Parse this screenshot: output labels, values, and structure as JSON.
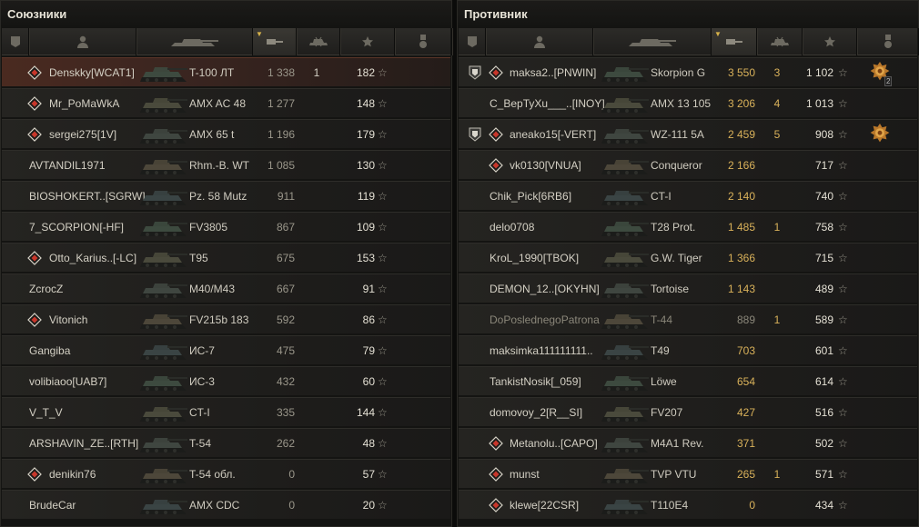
{
  "left": {
    "title": "Союзники",
    "rows": [
      {
        "name": "Denskky[WCAT1]",
        "vehicle": "T-100 ЛТ",
        "damage": "1 338",
        "frags": "1",
        "xp": "182",
        "platoon": true,
        "self": true
      },
      {
        "name": "Mr_PoMaWkA",
        "vehicle": "AMX AC 48",
        "damage": "1 277",
        "frags": "",
        "xp": "148",
        "platoon": true,
        "self": false
      },
      {
        "name": "sergei275[1V]",
        "vehicle": "AMX 65 t",
        "damage": "1 196",
        "frags": "",
        "xp": "179",
        "platoon": true,
        "self": false
      },
      {
        "name": "AVTANDIL1971",
        "vehicle": "Rhm.-B. WT",
        "damage": "1 085",
        "frags": "",
        "xp": "130",
        "platoon": false,
        "self": false
      },
      {
        "name": "BIOSHOKERT..[SGRW]",
        "vehicle": "Pz. 58 Mutz",
        "damage": "911",
        "frags": "",
        "xp": "119",
        "platoon": false,
        "self": false
      },
      {
        "name": "7_SCORPION[-HF]",
        "vehicle": "FV3805",
        "damage": "867",
        "frags": "",
        "xp": "109",
        "platoon": false,
        "self": false
      },
      {
        "name": "Otto_Karius..[-LC]",
        "vehicle": "T95",
        "damage": "675",
        "frags": "",
        "xp": "153",
        "platoon": true,
        "self": false
      },
      {
        "name": "ZcrocZ",
        "vehicle": "M40/M43",
        "damage": "667",
        "frags": "",
        "xp": "91",
        "platoon": false,
        "self": false
      },
      {
        "name": "Vitonich",
        "vehicle": "FV215b 183",
        "damage": "592",
        "frags": "",
        "xp": "86",
        "platoon": true,
        "self": false
      },
      {
        "name": "Gangiba",
        "vehicle": "ИС-7",
        "damage": "475",
        "frags": "",
        "xp": "79",
        "platoon": false,
        "self": false
      },
      {
        "name": "volibiaoo[UAB7]",
        "vehicle": "ИС-3",
        "damage": "432",
        "frags": "",
        "xp": "60",
        "platoon": false,
        "self": false
      },
      {
        "name": "V_T_V",
        "vehicle": "CT-I",
        "damage": "335",
        "frags": "",
        "xp": "144",
        "platoon": false,
        "self": false
      },
      {
        "name": "ARSHAVIN_ZE..[RTH]",
        "vehicle": "T-54",
        "damage": "262",
        "frags": "",
        "xp": "48",
        "platoon": false,
        "self": false
      },
      {
        "name": "denikin76",
        "vehicle": "T-54 обл.",
        "damage": "0",
        "frags": "",
        "xp": "57",
        "platoon": true,
        "self": false
      },
      {
        "name": "BrudeCar",
        "vehicle": "AMX CDC",
        "damage": "0",
        "frags": "",
        "xp": "20",
        "platoon": false,
        "self": false
      }
    ]
  },
  "right": {
    "title": "Противник",
    "rows": [
      {
        "name": "maksa2..[PNWIN]",
        "vehicle": "Skorpion G",
        "damage": "3 550",
        "frags": "3",
        "xp": "1 102",
        "platoon": true,
        "shield": true,
        "medal": true,
        "medal_count": "2",
        "dead": false
      },
      {
        "name": "C_BepTyXu___..[INOY]",
        "vehicle": "AMX 13 105",
        "damage": "3 206",
        "frags": "4",
        "xp": "1 013",
        "platoon": false,
        "shield": false,
        "medal": false,
        "dead": false
      },
      {
        "name": "aneako15[-VERT]",
        "vehicle": "WZ-111 5A",
        "damage": "2 459",
        "frags": "5",
        "xp": "908",
        "platoon": true,
        "shield": true,
        "medal": true,
        "medal_count": "",
        "dead": false
      },
      {
        "name": "vk0130[VNUA]",
        "vehicle": "Conqueror",
        "damage": "2 166",
        "frags": "",
        "xp": "717",
        "platoon": true,
        "shield": false,
        "medal": false,
        "dead": false
      },
      {
        "name": "Chik_Pick[6RB6]",
        "vehicle": "CT-I",
        "damage": "2 140",
        "frags": "",
        "xp": "740",
        "platoon": false,
        "shield": false,
        "medal": false,
        "dead": false
      },
      {
        "name": "delo0708",
        "vehicle": "T28 Prot.",
        "damage": "1 485",
        "frags": "1",
        "xp": "758",
        "platoon": false,
        "shield": false,
        "medal": false,
        "dead": false
      },
      {
        "name": "KroL_1990[TBOK]",
        "vehicle": "G.W. Tiger",
        "damage": "1 366",
        "frags": "",
        "xp": "715",
        "platoon": false,
        "shield": false,
        "medal": false,
        "dead": false
      },
      {
        "name": "DEMON_12..[OKYHN]",
        "vehicle": "Tortoise",
        "damage": "1 143",
        "frags": "",
        "xp": "489",
        "platoon": false,
        "shield": false,
        "medal": false,
        "dead": false
      },
      {
        "name": "DoPoslednegoPatrona",
        "vehicle": "T-44",
        "damage": "889",
        "frags": "1",
        "xp": "589",
        "platoon": false,
        "shield": false,
        "medal": false,
        "dead": true
      },
      {
        "name": "maksimka111111111..",
        "vehicle": "T49",
        "damage": "703",
        "frags": "",
        "xp": "601",
        "platoon": false,
        "shield": false,
        "medal": false,
        "dead": false
      },
      {
        "name": "TankistNosik[_059]",
        "vehicle": "Löwe",
        "damage": "654",
        "frags": "",
        "xp": "614",
        "platoon": false,
        "shield": false,
        "medal": false,
        "dead": false
      },
      {
        "name": "domovoy_2[R__SI]",
        "vehicle": "FV207",
        "damage": "427",
        "frags": "",
        "xp": "516",
        "platoon": false,
        "shield": false,
        "medal": false,
        "dead": false
      },
      {
        "name": "Metanolu..[CAPO]",
        "vehicle": "M4A1 Rev.",
        "damage": "371",
        "frags": "",
        "xp": "502",
        "platoon": true,
        "shield": false,
        "medal": false,
        "dead": false
      },
      {
        "name": "munst",
        "vehicle": "TVP VTU",
        "damage": "265",
        "frags": "1",
        "xp": "571",
        "platoon": true,
        "shield": false,
        "medal": false,
        "dead": false
      },
      {
        "name": "klewe[22CSR]",
        "vehicle": "T110E4",
        "damage": "0",
        "frags": "",
        "xp": "434",
        "platoon": true,
        "shield": false,
        "medal": false,
        "dead": false
      }
    ]
  },
  "header_icons": [
    "badge-icon",
    "player-icon",
    "tank-icon",
    "damage-icon",
    "frags-icon",
    "xp-star-icon",
    "medal-icon"
  ],
  "star_glyph": "☆",
  "colors": {
    "accent_gold": "#d9b15a",
    "self_row": "#4a2a20",
    "platoon_red": "#c0392b"
  }
}
